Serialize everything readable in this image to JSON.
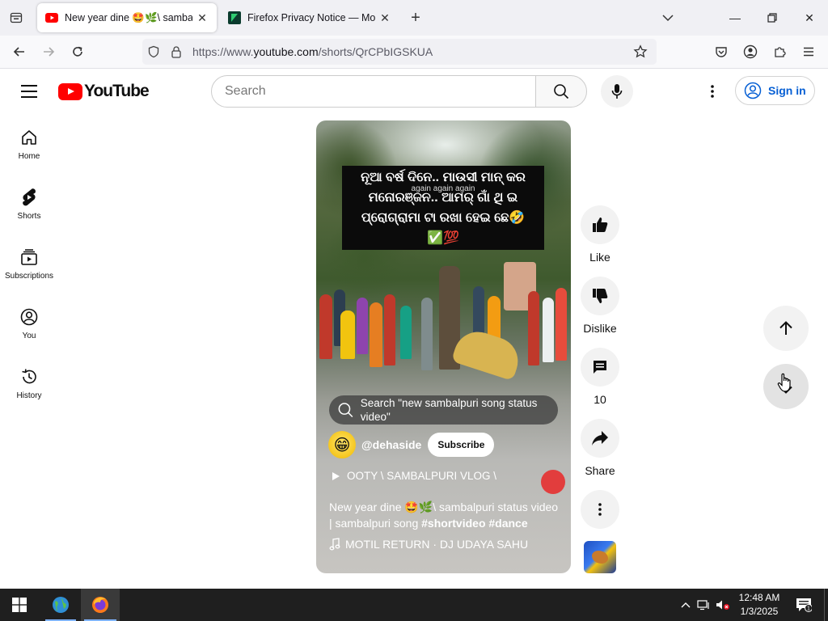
{
  "browser": {
    "tabs": [
      {
        "title": "New year dine 🤩🌿\\ sambalpuri",
        "favicon": "youtube-icon",
        "active": true
      },
      {
        "title": "Firefox Privacy Notice — Mozilla",
        "favicon": "mozilla-icon",
        "active": false
      }
    ],
    "url": {
      "scheme": "https://www.",
      "host": "youtube.com",
      "path": "/shorts/QrCPbIGSKUA"
    },
    "window_controls": {
      "minimize": "—",
      "maximize": "☐",
      "close": "✕"
    },
    "new_tab": "+"
  },
  "youtube": {
    "logo_text": "YouTube",
    "search": {
      "placeholder": "Search",
      "value": ""
    },
    "sign_in": "Sign in",
    "guide": [
      {
        "label": "Home",
        "icon": "home-icon"
      },
      {
        "label": "Shorts",
        "icon": "shorts-icon"
      },
      {
        "label": "Subscriptions",
        "icon": "subscriptions-icon"
      },
      {
        "label": "You",
        "icon": "you-icon"
      },
      {
        "label": "History",
        "icon": "history-icon"
      }
    ],
    "short": {
      "caption_line1": "ନୂଆ ବର୍ଷ ଦିନେ.. ମାଉସୀ ମାନ୍ କର",
      "caption_line2": "ମନୋରଞ୍ଜନ.. ଆମର୍ ଗାଁ ଥି ଇ",
      "caption_line3": "ପ୍ରୋଗ୍ରାମା ଟା ରଖା ହେଇ ଛେ🤣✅💯",
      "caption_overlay": "again again again",
      "search_suggestion": "Search \"new sambalpuri song status video\"",
      "channel_emoji": "😁",
      "channel_name": "@dehaside",
      "subscribe_label": "Subscribe",
      "playlist": "OOTY \\ SAMBALPURI VLOG \\",
      "title_prefix": "New year dine 🤩🌿\\ sambalpuri status video | sambalpuri song",
      "title_tags": "#shortvideo #dance",
      "audio": "MOTIL RETURN · DJ UDAYA SAHU"
    },
    "actions": {
      "like": "Like",
      "dislike": "Dislike",
      "comments": "10",
      "share": "Share"
    }
  },
  "taskbar": {
    "time": "12:48 AM",
    "date": "1/3/2025",
    "notification_count": "1"
  },
  "colors": {
    "youtube_red": "#ff0000",
    "link_blue": "#065fd4",
    "taskbar": "#1f1f1f"
  }
}
